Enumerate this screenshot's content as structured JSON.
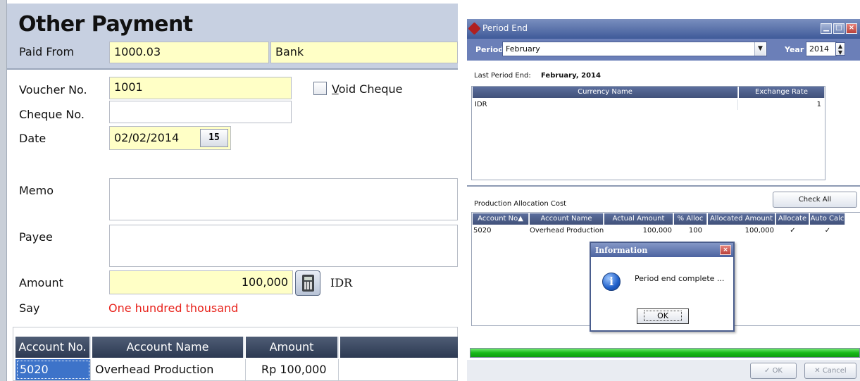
{
  "other_payment": {
    "title": "Other Payment",
    "paid_from_label": "Paid From",
    "paid_from_account": "1000.03",
    "paid_from_name": "Bank",
    "voucher_label": "Voucher No.",
    "voucher_value": "1001",
    "void_cheque_label": "Void Cheque",
    "cheque_label": "Cheque No.",
    "cheque_value": "",
    "date_label": "Date",
    "date_value": "02/02/2014",
    "calendar_icon": "15",
    "memo_label": "Memo",
    "memo_value": "",
    "payee_label": "Payee",
    "payee_value": "",
    "amount_label": "Amount",
    "amount_value": "100,000",
    "currency": "IDR",
    "say_label": "Say",
    "say_value": "One hundred thousand",
    "grid": {
      "columns": [
        "Account No.",
        "Account Name",
        "Amount"
      ],
      "rows": [
        [
          "5020",
          "Overhead Production",
          "Rp 100,000"
        ]
      ]
    }
  },
  "period_end": {
    "window_title": "Period End",
    "period_label": "Period",
    "period_value": "February",
    "year_label": "Year",
    "year_value": "2014",
    "last_period_label": "Last Period End:",
    "last_period_value": "February, 2014",
    "currency_columns": [
      "Currency Name",
      "Exchange Rate"
    ],
    "currency_rows": [
      [
        "IDR",
        "1"
      ]
    ],
    "production_label": "Production Allocation Cost",
    "check_all_label": "Check All",
    "alloc_columns": [
      "Account No▲",
      "Account Name",
      "Actual Amount",
      "% Alloc",
      "Allocated Amount",
      "Allocate",
      "Auto Calc"
    ],
    "alloc_rows": [
      [
        "5020",
        "Overhead Production",
        "100,000",
        "100",
        "100,000",
        "✓",
        "✓"
      ]
    ],
    "progress": 1.0,
    "ok_label": "OK",
    "cancel_label": "Cancel"
  },
  "info_dialog": {
    "title": "Information",
    "message": "Period end complete ...",
    "ok_label": "OK"
  },
  "colors": {
    "header_bg": "#c7d0e1",
    "required_field": "#ffffc6",
    "say_text": "#e8231c",
    "grid_header": "#2c3952",
    "progress": "#18b818"
  }
}
